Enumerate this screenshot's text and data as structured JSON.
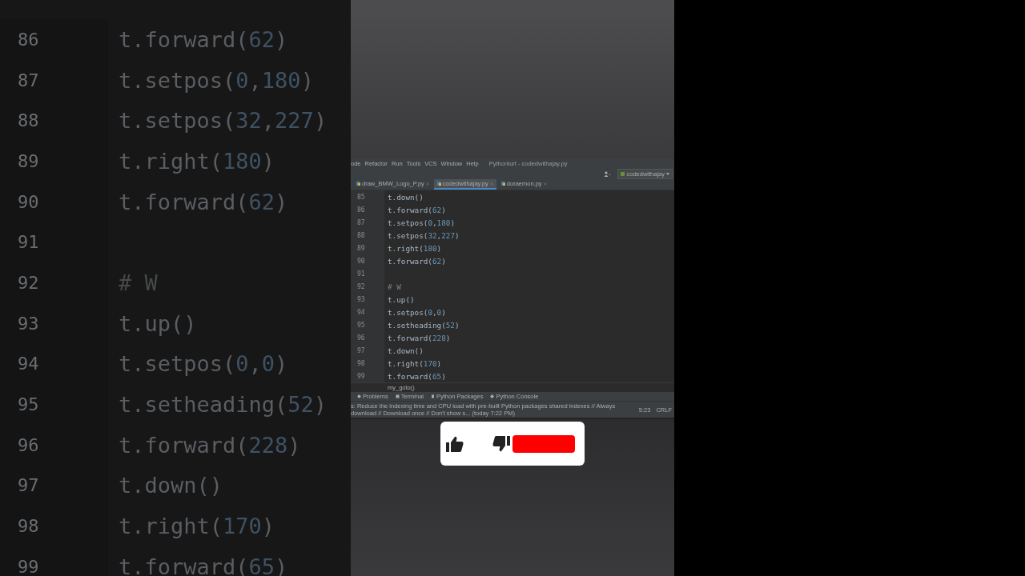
{
  "backdrop": {
    "lines": [
      {
        "number": "86",
        "code": "t.forward(62)"
      },
      {
        "number": "87",
        "code": "t.setpos(0,180)"
      },
      {
        "number": "88",
        "code": "t.setpos(32,227)"
      },
      {
        "number": "89",
        "code": "t.right(180)"
      },
      {
        "number": "90",
        "code": "t.forward(62)"
      },
      {
        "number": "91"
      },
      {
        "number": "92",
        "code": "# W"
      },
      {
        "number": "93",
        "code": "t.up()"
      },
      {
        "number": "94",
        "code": "t.setpos(0,0)"
      },
      {
        "number": "95",
        "code": "t.setheading(52)"
      },
      {
        "number": "96",
        "code": "t.forward(228)"
      },
      {
        "number": "97",
        "code": "t.down()"
      },
      {
        "number": "98",
        "code": "t.right(170)"
      },
      {
        "number": "99",
        "code": "t.forward(65)"
      }
    ]
  },
  "ide": {
    "menu": [
      "ode",
      "Refactor",
      "Run",
      "Tools",
      "VCS",
      "Window",
      "Help"
    ],
    "title": "Pythonturt - codedwithajay.py",
    "run_config": "codedwithajay",
    "tabs": [
      {
        "label": "draw_BMW_Logo_P.py",
        "selected": false
      },
      {
        "label": "codedwithajay.py",
        "selected": true
      },
      {
        "label": "doraemon.py",
        "selected": false
      }
    ],
    "editor": {
      "lines": [
        {
          "number": "85",
          "code": "t.down()"
        },
        {
          "number": "86",
          "code": "t.forward(62)"
        },
        {
          "number": "87",
          "code": "t.setpos(0,180)"
        },
        {
          "number": "88",
          "code": "t.setpos(32,227)"
        },
        {
          "number": "89",
          "code": "t.right(180)"
        },
        {
          "number": "90",
          "code": "t.forward(62)"
        },
        {
          "number": "91"
        },
        {
          "number": "92",
          "code": "# W"
        },
        {
          "number": "93",
          "code": "t.up()"
        },
        {
          "number": "94",
          "code": "t.setpos(0,0)"
        },
        {
          "number": "95",
          "code": "t.setheading(52)"
        },
        {
          "number": "96",
          "code": "t.forward(228)"
        },
        {
          "number": "97",
          "code": "t.down()"
        },
        {
          "number": "98",
          "code": "t.right(170)"
        },
        {
          "number": "99",
          "code": "t.forward(65)"
        }
      ]
    },
    "breadcrumb": "my_goto()",
    "tool_tabs": [
      "Problems",
      "Terminal",
      "Python Packages",
      "Python Console"
    ],
    "status": {
      "message": "s: Reduce the indexing time and CPU load with pre-built Python packages shared indexes // Always download // Download once // Don't show s... (today 7:22 PM)",
      "position": "5:23",
      "line_ending": "CRLF"
    }
  }
}
